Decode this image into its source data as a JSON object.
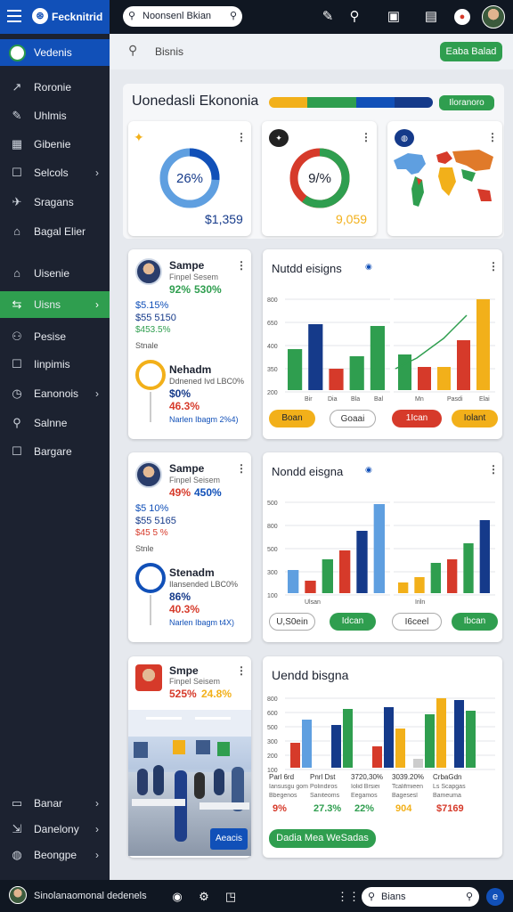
{
  "app": {
    "brand": "Fecknitrid",
    "search_text": "Noonsenl Bkian"
  },
  "colors": {
    "blue": "#1150b8",
    "green": "#2f9e4f",
    "yellow": "#f2b01a",
    "red": "#d63a2a",
    "navy": "#153a8a",
    "lightblue": "#5f9fe0"
  },
  "sidebar": {
    "header": "Vedenis",
    "items": [
      {
        "icon": "trend-icon",
        "glyph": "↗",
        "label": "Roronie",
        "chevron": false
      },
      {
        "icon": "pencil-icon",
        "glyph": "✎",
        "label": "Uhlmis",
        "chevron": false
      },
      {
        "icon": "grid-icon",
        "glyph": "▦",
        "label": "Gibenie",
        "chevron": false
      },
      {
        "icon": "square-icon",
        "glyph": "☐",
        "label": "Selcols",
        "chevron": true
      },
      {
        "icon": "bird-icon",
        "glyph": "✈",
        "label": "Sragans",
        "chevron": false
      },
      {
        "icon": "home-icon",
        "glyph": "⌂",
        "label": "Bagal Elier",
        "chevron": false
      },
      {
        "icon": "bank-icon",
        "glyph": "⌂",
        "label": "Uisenie",
        "chevron": false
      },
      {
        "icon": "link-icon",
        "glyph": "⇆",
        "label": "Uisns",
        "chevron": true,
        "active": true
      },
      {
        "icon": "people-icon",
        "glyph": "⚇",
        "label": "Pesise",
        "chevron": false
      },
      {
        "icon": "square-icon",
        "glyph": "☐",
        "label": "Iinpimis",
        "chevron": false
      },
      {
        "icon": "clock-icon",
        "glyph": "◷",
        "label": "Eanonois",
        "chevron": true
      },
      {
        "icon": "user-icon",
        "glyph": "⚲",
        "label": "Salnne",
        "chevron": false
      },
      {
        "icon": "doc-icon",
        "glyph": "☐",
        "label": "Bargare",
        "chevron": false
      }
    ],
    "bottom": [
      {
        "icon": "monitor-icon",
        "glyph": "▭",
        "label": "Banar"
      },
      {
        "icon": "export-icon",
        "glyph": "⇲",
        "label": "Danelony"
      },
      {
        "icon": "globe-icon",
        "glyph": "◍",
        "label": "Beongpe"
      }
    ]
  },
  "header": {
    "search_label": "Bisnis",
    "button": "Eaba Balad"
  },
  "overview": {
    "title": "Uonedasli Ekononia",
    "tag": "Iloranoro",
    "cards": [
      {
        "center": "26%",
        "value": "$1,359"
      },
      {
        "center": "9/%",
        "value": "9,059"
      },
      {
        "center": "",
        "value": ""
      }
    ]
  },
  "donut": [
    {
      "frac": 0.26,
      "color": "#1150b8",
      "track": "#5f9fe0"
    },
    {
      "frac": 0.6,
      "color": "#2f9e4f",
      "track": "#d63a2a"
    }
  ],
  "rows": [
    {
      "name": "Sampe",
      "sub": "Finpel Sesem",
      "p1": "92%",
      "p2": "530%",
      "p1c": "#2f9e4f",
      "p2c": "#2f9e4f",
      "l1": "$5.15%",
      "l2": "$55 5150",
      "l3": "$453.5%",
      "label": "Stnale",
      "name2": "Nehadm",
      "sub2": "Ddnened Ivd LBC0%",
      "v1": "$0%",
      "v2": "46.3%",
      "foot": "Narlen Ibagm 2%­4)",
      "chart_title": "Nutdd eisigns",
      "btns": [
        "Boan",
        "Goaai",
        "1Ican",
        "Iolant"
      ]
    },
    {
      "name": "Sampe",
      "sub": "Finpel Seisem",
      "p1": "49%",
      "p2": "450%",
      "p1c": "#d63a2a",
      "p2c": "#1150b8",
      "l1": "$5 10%",
      "l2": "$55 5165",
      "l3": "$45 5 %",
      "label": "Stnle",
      "name2": "Stenadm",
      "sub2": "Ilansended LBC0%",
      "v1": "86%",
      "v2": "40.3%",
      "foot": "Narlen Ibagm t4X)",
      "chart_title": "Nondd eisgna",
      "btns": [
        "U,S0ein",
        "Idcan",
        "I6ceel",
        "Ibcan"
      ]
    }
  ],
  "row3": {
    "name": "Smpe",
    "sub": "Finpel Seisem",
    "p1": "525%",
    "p2": "24.8%",
    "photo_label": "Aeacis",
    "chart_title": "Uendd bisgna",
    "cols": [
      {
        "t": "Parl 6rd",
        "a": "Iansusgu gom",
        "b": "Bbegenos",
        "v": "9%",
        "c": "#d63a2a"
      },
      {
        "t": "Pnrl Dst",
        "a": "Polindiros",
        "b": "Saniteoms",
        "v": "27.3%",
        "c": "#2f9e4f"
      },
      {
        "t": "3720,30%",
        "a": "Iolid Brsiei",
        "b": "Eegamos",
        "v": "22%",
        "c": "#2f9e4f"
      },
      {
        "t": "3039.20%",
        "a": "Tcalifmieen",
        "b": "Bagesesl",
        "v": "904",
        "c": "#f2b01a"
      },
      {
        "t": "CrbaGdn",
        "a": "Ls Scapgas",
        "b": "Bameuma",
        "v": "$7169",
        "c": "#d63a2a"
      }
    ],
    "button": "Dadia Mea WeSadas"
  },
  "footer": {
    "label": "Sinolanaomonal dedenels",
    "search": "Bians"
  },
  "chart_data": [
    {
      "type": "bar",
      "title": "Nutdd eisigns",
      "ylabels": [
        "800",
        "650",
        "400",
        "350",
        "200"
      ],
      "xlabels": [
        "Bir",
        "Dia",
        "Bla",
        "Bal"
      ],
      "series_left": {
        "values": [
          46,
          74,
          24,
          38,
          72
        ],
        "colors": [
          "#2f9e4f",
          "#153a8a",
          "#d63a2a",
          "#2f9e4f",
          "#2f9e4f"
        ]
      },
      "series_right": {
        "values": [
          40,
          26,
          26,
          56,
          102
        ],
        "colors": [
          "#2f9e4f",
          "#d63a2a",
          "#f2b01a",
          "#d63a2a",
          "#f2b01a"
        ]
      },
      "xlabels_right": [
        "Mn",
        "Pasdi",
        "Elai"
      ],
      "line": true
    },
    {
      "type": "bar",
      "title": "Nondd eisgna",
      "ylabels": [
        "500",
        "800",
        "500",
        "300",
        "100"
      ],
      "xlabels": [
        "Ulsan"
      ],
      "series_left": {
        "values": [
          26,
          14,
          38,
          48,
          70,
          100
        ],
        "colors": [
          "#5f9fe0",
          "#d63a2a",
          "#2f9e4f",
          "#d63a2a",
          "#153a8a",
          "#5f9fe0"
        ]
      },
      "series_right": {
        "values": [
          12,
          18,
          34,
          38,
          56,
          82
        ],
        "colors": [
          "#f2b01a",
          "#f2b01a",
          "#2f9e4f",
          "#d63a2a",
          "#2f9e4f",
          "#153a8a"
        ]
      },
      "xlabels_right": [
        "Iriln"
      ],
      "line": false
    },
    {
      "type": "bar",
      "title": "Uendd bisgna",
      "ylabels": [
        "800",
        "600",
        "500",
        "300",
        "200",
        "100"
      ],
      "groups": [
        [
          [
            "#d63a2a",
            28
          ],
          [
            "#5f9fe0",
            54
          ]
        ],
        [
          [
            "#153a8a",
            48
          ],
          [
            "#2f9e4f",
            66
          ]
        ],
        [
          [
            "#d63a2a",
            24
          ],
          [
            "#153a8a",
            68
          ],
          [
            "#f2b01a",
            44
          ]
        ],
        [
          [
            "#ccc",
            10
          ],
          [
            "#2f9e4f",
            60
          ],
          [
            "#f2b01a",
            78
          ]
        ],
        [
          [
            "#153a8a",
            76
          ],
          [
            "#2f9e4f",
            64
          ]
        ]
      ]
    }
  ]
}
